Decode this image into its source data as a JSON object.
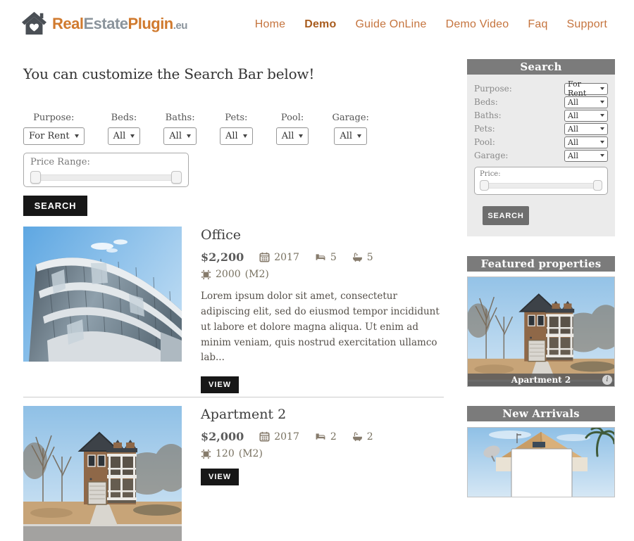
{
  "brand": {
    "real": "Real",
    "estate": "Estate",
    "plugin": "Plugin",
    "tld": ".eu"
  },
  "nav": {
    "items": [
      {
        "label": "Home",
        "active": false
      },
      {
        "label": "Demo",
        "active": true
      },
      {
        "label": "Guide OnLine",
        "active": false
      },
      {
        "label": "Demo Video",
        "active": false
      },
      {
        "label": "Faq",
        "active": false
      },
      {
        "label": "Support",
        "active": false
      }
    ]
  },
  "page": {
    "heading": "You can customize the Search Bar below!"
  },
  "search_bar": {
    "fields": [
      {
        "label": "Purpose:",
        "value": "For Rent"
      },
      {
        "label": "Beds:",
        "value": "All"
      },
      {
        "label": "Baths:",
        "value": "All"
      },
      {
        "label": "Pets:",
        "value": "All"
      },
      {
        "label": "Pool:",
        "value": "All"
      },
      {
        "label": "Garage:",
        "value": "All"
      }
    ],
    "price_label": "Price Range:",
    "button_label": "SEARCH"
  },
  "listings": [
    {
      "title": "Office",
      "price": "$2,200",
      "year": "2017",
      "beds": "5",
      "baths": "5",
      "area": "2000",
      "area_unit": "(M2)",
      "description": "Lorem ipsum dolor sit amet, consectetur adipiscing elit, sed do eiusmod tempor incididunt ut labore et dolore magna aliqua. Ut enim ad minim veniam, quis nostrud exercitation ullamco lab...",
      "view_label": "VIEW"
    },
    {
      "title": "Apartment 2",
      "price": "$2,000",
      "year": "2017",
      "beds": "2",
      "baths": "2",
      "area": "120",
      "area_unit": "(M2)",
      "view_label": "VIEW"
    }
  ],
  "sidebar": {
    "search": {
      "title": "Search",
      "fields": [
        {
          "label": "Purpose:",
          "value": "For Rent"
        },
        {
          "label": "Beds:",
          "value": "All"
        },
        {
          "label": "Baths:",
          "value": "All"
        },
        {
          "label": "Pets:",
          "value": "All"
        },
        {
          "label": "Pool:",
          "value": "All"
        },
        {
          "label": "Garage:",
          "value": "All"
        }
      ],
      "price_label": "Price:",
      "button_label": "SEARCH"
    },
    "featured": {
      "title": "Featured properties",
      "caption": "Apartment 2",
      "info_glyph": "i"
    },
    "new_arrivals": {
      "title": "New Arrivals"
    }
  },
  "icons": {
    "logo": "house-heart-icon",
    "meta": [
      "calendar-icon",
      "bed-icon",
      "bath-icon",
      "area-icon"
    ],
    "dropdown": "chevron-down-icon",
    "caption": "info-icon"
  },
  "colors": {
    "accent_orange": "#c5743e",
    "accent_orange_active": "#a85c1e",
    "logo_orange": "#d07a2e",
    "logo_gray": "#8b949c",
    "widget_header_gray": "#7b7b7b",
    "widget_body_gray": "#ebebeb",
    "button_black": "#171717",
    "button_gray": "#6e6e6e",
    "meta_icon_brown": "#867b6c"
  }
}
